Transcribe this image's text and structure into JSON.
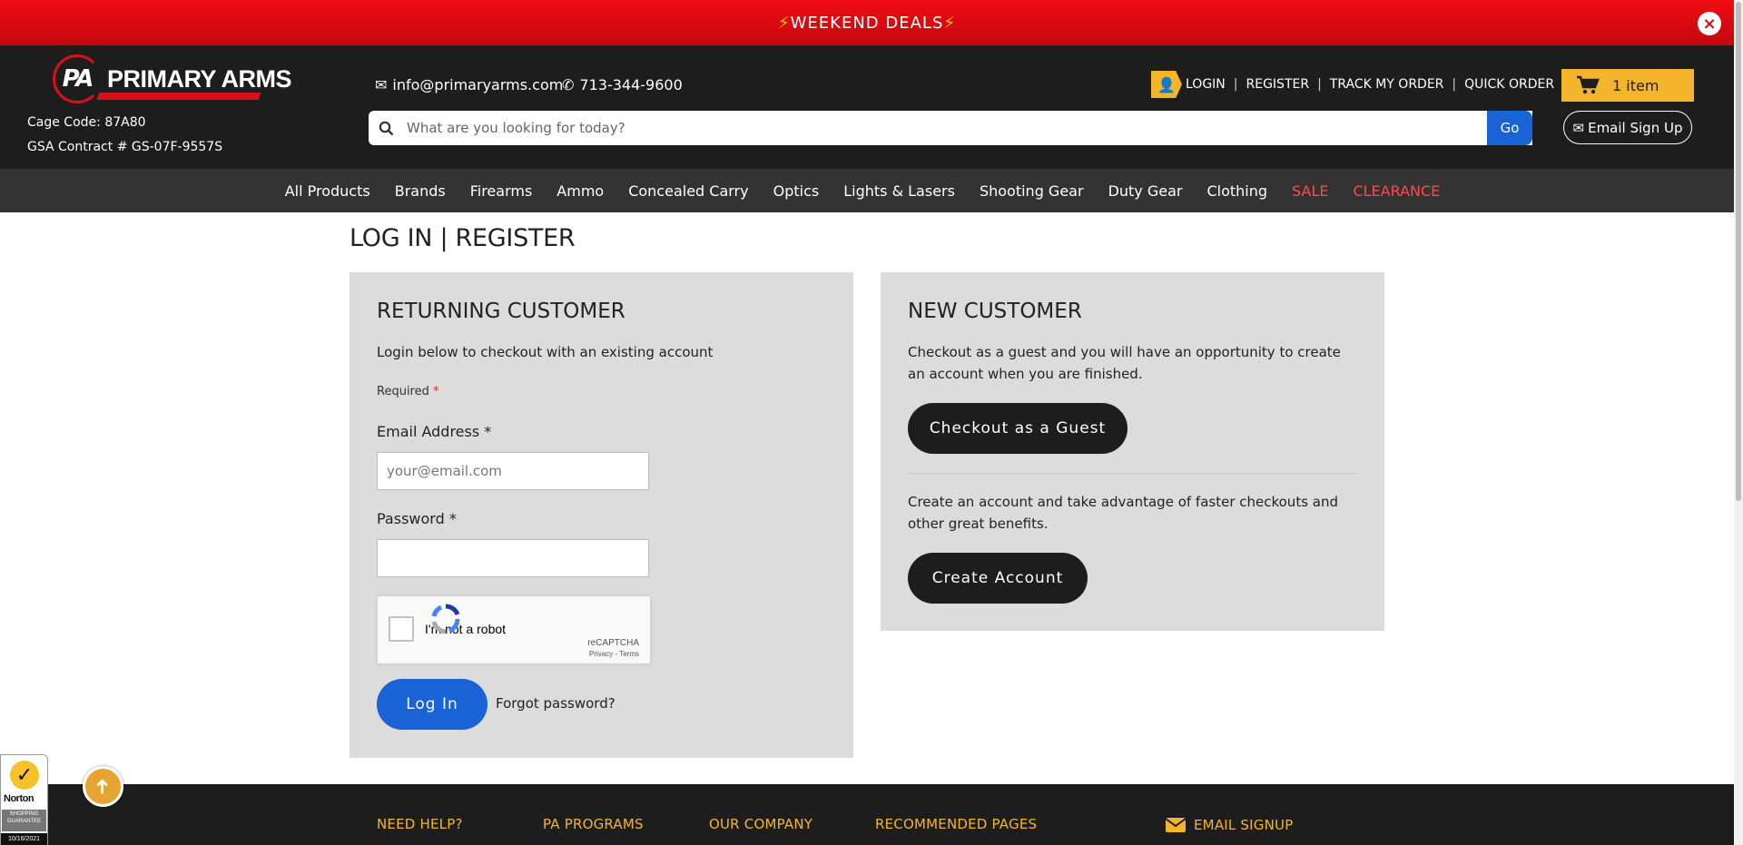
{
  "promo": {
    "text": "WEEKEND DEALS",
    "bolt": "⚡",
    "close_icon": "×"
  },
  "header": {
    "logo_mark": "PA",
    "logo_text": "PRIMARY ARMS",
    "cage_code": "Cage Code: 87A80",
    "gsa_contract": "GSA Contract # GS-07F-9557S",
    "email": "info@primaryarms.com",
    "phone": "713-344-9600",
    "account_links": [
      "LOGIN",
      "REGISTER",
      "TRACK MY ORDER",
      "QUICK ORDER"
    ],
    "cart_label": "1 item",
    "search_placeholder": "What are you looking for today?",
    "search_button": "Go",
    "email_signup": "Email Sign Up"
  },
  "nav": {
    "items": [
      "All Products",
      "Brands",
      "Firearms",
      "Ammo",
      "Concealed Carry",
      "Optics",
      "Lights & Lasers",
      "Shooting Gear",
      "Duty Gear",
      "Clothing"
    ],
    "sale": "SALE",
    "clearance": "CLEARANCE",
    "sale_color": "#ff4a4a"
  },
  "page_title": "LOG IN | REGISTER",
  "returning": {
    "title": "RETURNING CUSTOMER",
    "intro": "Login below to checkout with an existing account",
    "required_label": "Required",
    "required_mark": "*",
    "email_label": "Email Address *",
    "email_placeholder": "your@email.com",
    "password_label": "Password *",
    "captcha_text": "I'm not a robot",
    "captcha_brand": "reCAPTCHA",
    "captcha_terms": "Privacy - Terms",
    "login_button": "Log In",
    "forgot": "Forgot password?"
  },
  "new_customer": {
    "title": "NEW CUSTOMER",
    "guest_text": "Checkout as a guest and you will have an opportunity to create an account when you are finished.",
    "guest_button": "Checkout as a Guest",
    "create_text": "Create an account and take advantage of faster checkouts and other great benefits.",
    "create_button": "Create Account"
  },
  "footer": {
    "columns": [
      "NEED HELP?",
      "PA PROGRAMS",
      "OUR COMPANY",
      "RECOMMENDED PAGES"
    ],
    "email_signup": "EMAIL SIGNUP"
  },
  "norton": {
    "name": "Norton",
    "guarantee": "SHOPPING GUARANTEE",
    "date": "10/16/2021"
  },
  "colors": {
    "accent": "#f4b52c",
    "brand_red": "#d6111b",
    "primary_blue": "#1a63d6"
  }
}
